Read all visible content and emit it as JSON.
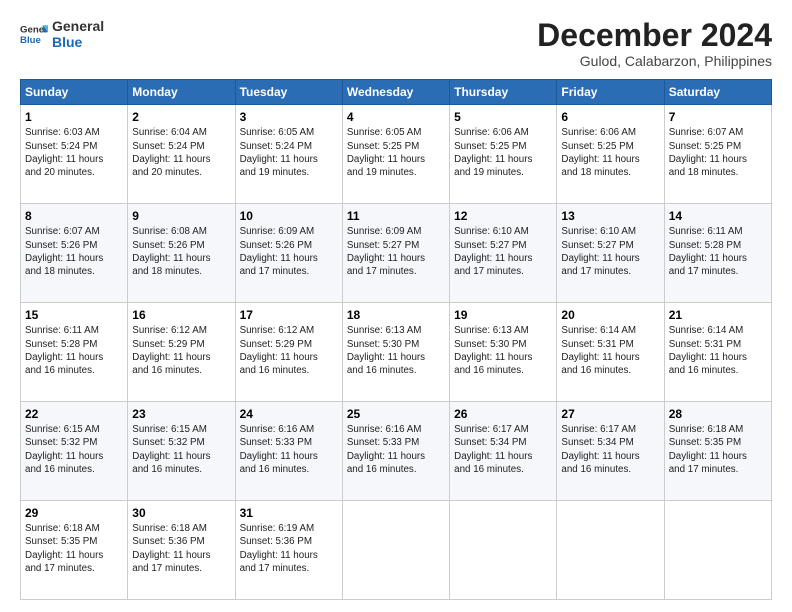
{
  "logo": {
    "line1": "General",
    "line2": "Blue"
  },
  "title": "December 2024",
  "subtitle": "Gulod, Calabarzon, Philippines",
  "days_of_week": [
    "Sunday",
    "Monday",
    "Tuesday",
    "Wednesday",
    "Thursday",
    "Friday",
    "Saturday"
  ],
  "weeks": [
    [
      {
        "day": "1",
        "info": "Sunrise: 6:03 AM\nSunset: 5:24 PM\nDaylight: 11 hours\nand 20 minutes."
      },
      {
        "day": "2",
        "info": "Sunrise: 6:04 AM\nSunset: 5:24 PM\nDaylight: 11 hours\nand 20 minutes."
      },
      {
        "day": "3",
        "info": "Sunrise: 6:05 AM\nSunset: 5:24 PM\nDaylight: 11 hours\nand 19 minutes."
      },
      {
        "day": "4",
        "info": "Sunrise: 6:05 AM\nSunset: 5:25 PM\nDaylight: 11 hours\nand 19 minutes."
      },
      {
        "day": "5",
        "info": "Sunrise: 6:06 AM\nSunset: 5:25 PM\nDaylight: 11 hours\nand 19 minutes."
      },
      {
        "day": "6",
        "info": "Sunrise: 6:06 AM\nSunset: 5:25 PM\nDaylight: 11 hours\nand 18 minutes."
      },
      {
        "day": "7",
        "info": "Sunrise: 6:07 AM\nSunset: 5:25 PM\nDaylight: 11 hours\nand 18 minutes."
      }
    ],
    [
      {
        "day": "8",
        "info": "Sunrise: 6:07 AM\nSunset: 5:26 PM\nDaylight: 11 hours\nand 18 minutes."
      },
      {
        "day": "9",
        "info": "Sunrise: 6:08 AM\nSunset: 5:26 PM\nDaylight: 11 hours\nand 18 minutes."
      },
      {
        "day": "10",
        "info": "Sunrise: 6:09 AM\nSunset: 5:26 PM\nDaylight: 11 hours\nand 17 minutes."
      },
      {
        "day": "11",
        "info": "Sunrise: 6:09 AM\nSunset: 5:27 PM\nDaylight: 11 hours\nand 17 minutes."
      },
      {
        "day": "12",
        "info": "Sunrise: 6:10 AM\nSunset: 5:27 PM\nDaylight: 11 hours\nand 17 minutes."
      },
      {
        "day": "13",
        "info": "Sunrise: 6:10 AM\nSunset: 5:27 PM\nDaylight: 11 hours\nand 17 minutes."
      },
      {
        "day": "14",
        "info": "Sunrise: 6:11 AM\nSunset: 5:28 PM\nDaylight: 11 hours\nand 17 minutes."
      }
    ],
    [
      {
        "day": "15",
        "info": "Sunrise: 6:11 AM\nSunset: 5:28 PM\nDaylight: 11 hours\nand 16 minutes."
      },
      {
        "day": "16",
        "info": "Sunrise: 6:12 AM\nSunset: 5:29 PM\nDaylight: 11 hours\nand 16 minutes."
      },
      {
        "day": "17",
        "info": "Sunrise: 6:12 AM\nSunset: 5:29 PM\nDaylight: 11 hours\nand 16 minutes."
      },
      {
        "day": "18",
        "info": "Sunrise: 6:13 AM\nSunset: 5:30 PM\nDaylight: 11 hours\nand 16 minutes."
      },
      {
        "day": "19",
        "info": "Sunrise: 6:13 AM\nSunset: 5:30 PM\nDaylight: 11 hours\nand 16 minutes."
      },
      {
        "day": "20",
        "info": "Sunrise: 6:14 AM\nSunset: 5:31 PM\nDaylight: 11 hours\nand 16 minutes."
      },
      {
        "day": "21",
        "info": "Sunrise: 6:14 AM\nSunset: 5:31 PM\nDaylight: 11 hours\nand 16 minutes."
      }
    ],
    [
      {
        "day": "22",
        "info": "Sunrise: 6:15 AM\nSunset: 5:32 PM\nDaylight: 11 hours\nand 16 minutes."
      },
      {
        "day": "23",
        "info": "Sunrise: 6:15 AM\nSunset: 5:32 PM\nDaylight: 11 hours\nand 16 minutes."
      },
      {
        "day": "24",
        "info": "Sunrise: 6:16 AM\nSunset: 5:33 PM\nDaylight: 11 hours\nand 16 minutes."
      },
      {
        "day": "25",
        "info": "Sunrise: 6:16 AM\nSunset: 5:33 PM\nDaylight: 11 hours\nand 16 minutes."
      },
      {
        "day": "26",
        "info": "Sunrise: 6:17 AM\nSunset: 5:34 PM\nDaylight: 11 hours\nand 16 minutes."
      },
      {
        "day": "27",
        "info": "Sunrise: 6:17 AM\nSunset: 5:34 PM\nDaylight: 11 hours\nand 16 minutes."
      },
      {
        "day": "28",
        "info": "Sunrise: 6:18 AM\nSunset: 5:35 PM\nDaylight: 11 hours\nand 17 minutes."
      }
    ],
    [
      {
        "day": "29",
        "info": "Sunrise: 6:18 AM\nSunset: 5:35 PM\nDaylight: 11 hours\nand 17 minutes."
      },
      {
        "day": "30",
        "info": "Sunrise: 6:18 AM\nSunset: 5:36 PM\nDaylight: 11 hours\nand 17 minutes."
      },
      {
        "day": "31",
        "info": "Sunrise: 6:19 AM\nSunset: 5:36 PM\nDaylight: 11 hours\nand 17 minutes."
      },
      {
        "day": "",
        "info": ""
      },
      {
        "day": "",
        "info": ""
      },
      {
        "day": "",
        "info": ""
      },
      {
        "day": "",
        "info": ""
      }
    ]
  ]
}
